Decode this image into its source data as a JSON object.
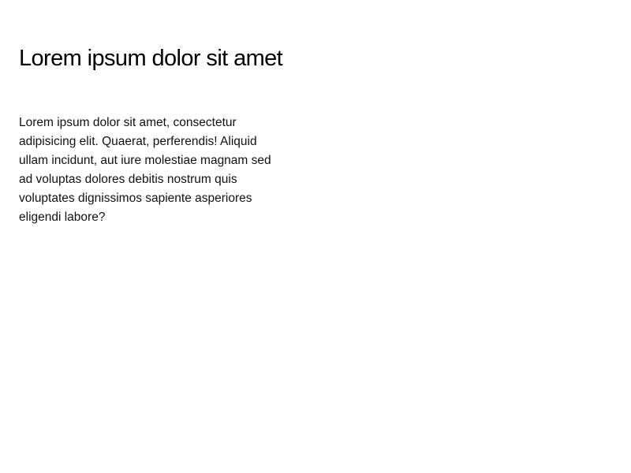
{
  "main": {
    "title": "Lorem ipsum dolor sit amet",
    "paragraph": "Lorem ipsum dolor sit amet, consectetur adipisicing elit. Quaerat, perferendis! Aliquid ullam incidunt, aut iure molestiae magnam sed ad voluptas dolores debitis nostrum quis voluptates dignissimos sapiente asperiores eligendi labore?"
  },
  "colors": {
    "background": "#ffffff",
    "text": "#000000"
  }
}
